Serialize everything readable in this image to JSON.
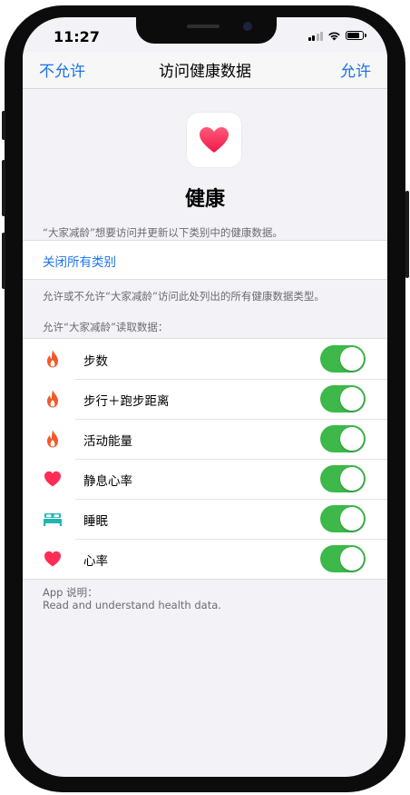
{
  "status_bar": {
    "time": "11:27"
  },
  "navbar": {
    "left_label": "不允许",
    "title": "访问健康数据",
    "right_label": "允许"
  },
  "app": {
    "icon": "heart-icon",
    "name": "健康",
    "request_text": "“大家减龄”想要访问并更新以下类别中的健康数据。"
  },
  "turn_off_all": "关闭所有类别",
  "note": "允许或不允许“大家减龄”访问此处列出的所有健康数据类型。",
  "section_header": "允许“大家减龄”读取数据：",
  "categories": [
    {
      "label": "步数",
      "icon": "flame-icon",
      "enabled": true
    },
    {
      "label": "步行＋跑步距离",
      "icon": "flame-icon",
      "enabled": true
    },
    {
      "label": "活动能量",
      "icon": "flame-icon",
      "enabled": true
    },
    {
      "label": "静息心率",
      "icon": "heart-icon",
      "enabled": true
    },
    {
      "label": "睡眠",
      "icon": "bed-icon",
      "enabled": true
    },
    {
      "label": "心率",
      "icon": "heart-icon",
      "enabled": true
    }
  ],
  "app_explanation": {
    "label": "App 说明：",
    "text": "Read and understand health data."
  },
  "colors": {
    "accent": "#1a73e8",
    "toggle_on": "#3db84a",
    "flame": "#f05a28",
    "heart": "#ff2d55",
    "bed": "#1fb5b3"
  }
}
